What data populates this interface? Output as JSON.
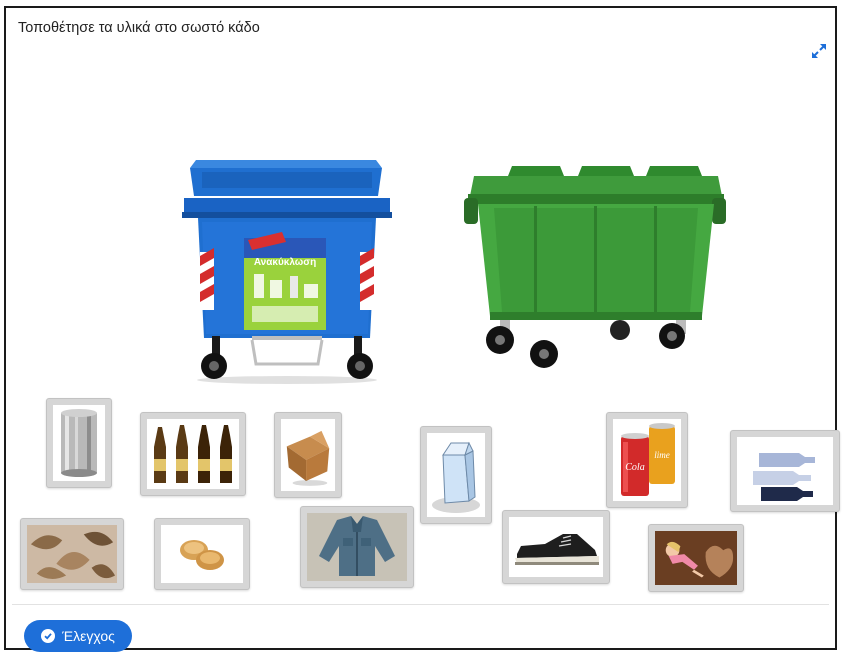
{
  "activity": {
    "instruction": "Τοποθέτησε τα υλικά στο σωστό κάδο",
    "check_button_label": "Έλεγχος"
  },
  "bins": [
    {
      "name": "blue-recycling-bin",
      "color": "#1f6fd0",
      "sticker_text": "Ανακύκλωση"
    },
    {
      "name": "green-general-waste-bin",
      "color": "#3f9b3c"
    }
  ],
  "items": [
    {
      "name": "tin-can"
    },
    {
      "name": "glass-bottles"
    },
    {
      "name": "cardboard-box"
    },
    {
      "name": "milk-carton"
    },
    {
      "name": "soda-cans",
      "label_text": "Cola"
    },
    {
      "name": "plastic-bottles"
    },
    {
      "name": "dry-leaves"
    },
    {
      "name": "bread-rolls"
    },
    {
      "name": "denim-jacket"
    },
    {
      "name": "sneaker"
    },
    {
      "name": "doll-and-toys"
    }
  ],
  "colors": {
    "accent": "#1e6fd9",
    "tile_background": "#d6d6d6",
    "frame_border": "#1a1a1a"
  }
}
